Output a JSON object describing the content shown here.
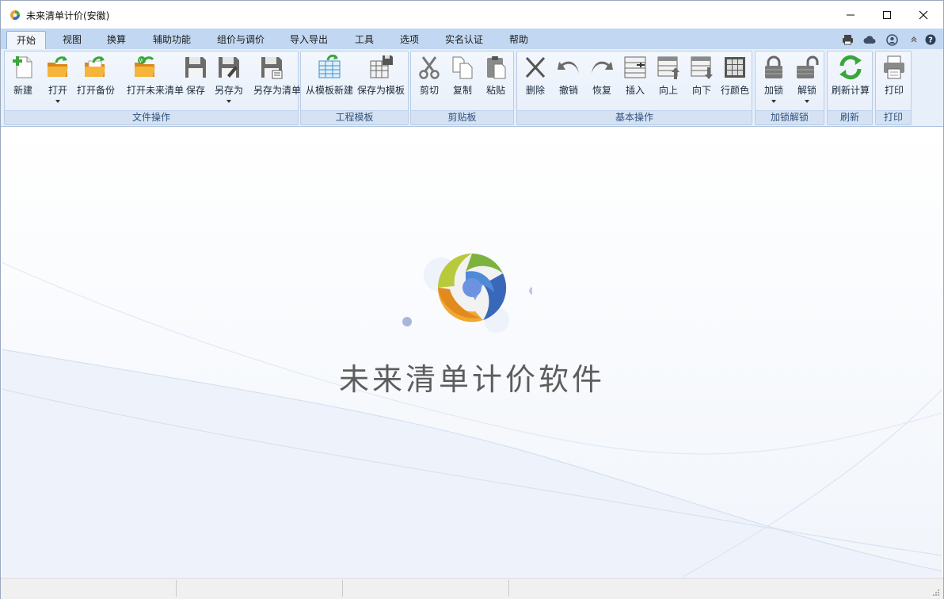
{
  "window": {
    "title": "未来清单计价(安徽)"
  },
  "tabs": [
    "开始",
    "视图",
    "换算",
    "辅助功能",
    "组价与调价",
    "导入导出",
    "工具",
    "选项",
    "实名认证",
    "帮助"
  ],
  "quick_icons": [
    "printer-icon",
    "cloud-icon",
    "user-account-icon",
    "collapse-ribbon-icon",
    "help-icon"
  ],
  "groups": {
    "file": {
      "caption": "文件操作",
      "buttons": [
        "新建",
        "打开",
        "打开备份",
        "打开未来清单",
        "保存",
        "另存为",
        "另存为清单"
      ]
    },
    "template": {
      "caption": "工程模板",
      "buttons": [
        "从模板新建",
        "保存为模板"
      ]
    },
    "clipboard": {
      "caption": "剪贴板",
      "buttons": [
        "剪切",
        "复制",
        "粘贴"
      ]
    },
    "basic": {
      "caption": "基本操作",
      "buttons": [
        "删除",
        "撤销",
        "恢复",
        "插入",
        "向上",
        "向下",
        "行颜色"
      ]
    },
    "lock": {
      "caption": "加锁解锁",
      "buttons": [
        "加锁",
        "解锁"
      ]
    },
    "refresh": {
      "caption": "刷新",
      "buttons": [
        "刷新计算"
      ]
    },
    "print": {
      "caption": "打印",
      "buttons": [
        "打印"
      ]
    }
  },
  "splash": {
    "title": "未来清单计价软件"
  },
  "colors": {
    "ribbon_tab_strip": "#c2d8f2",
    "ribbon_body": "#e7effa",
    "accent_green": "#2f9e2f",
    "folder_orange": "#f2a21d"
  }
}
